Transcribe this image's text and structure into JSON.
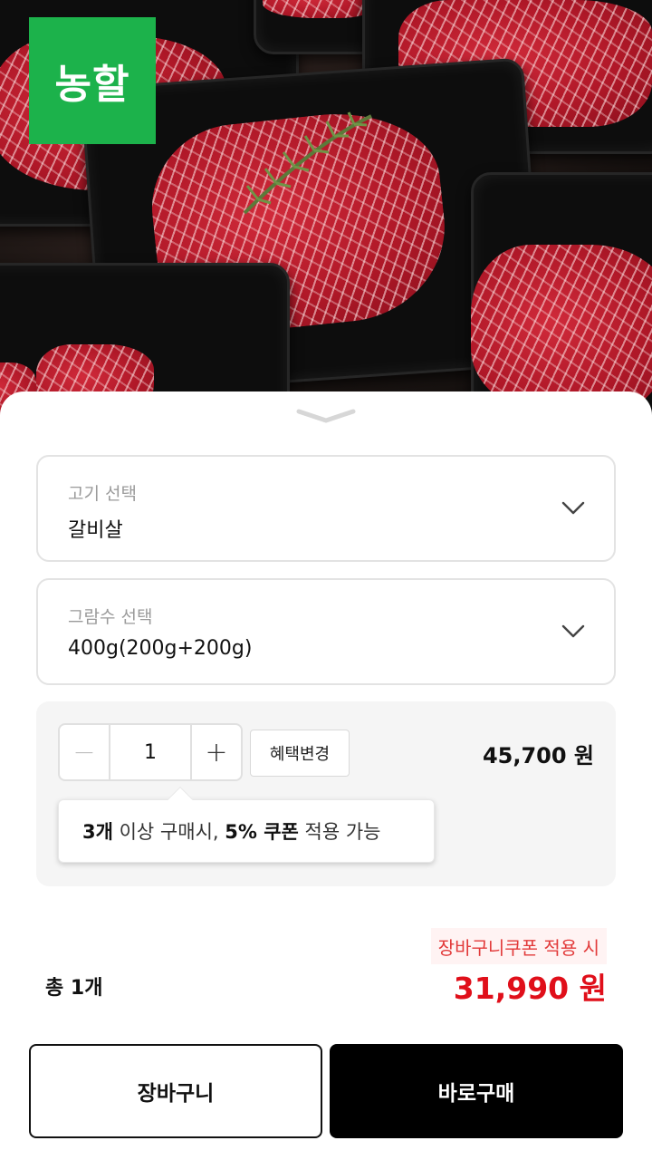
{
  "brand": {
    "logo_text": "농할"
  },
  "product_image": {
    "description_icon": "beef-photo"
  },
  "meat_select": {
    "label": "고기 선택",
    "value": "갈비살"
  },
  "weight_select": {
    "label": "그람수 선택",
    "value": "400g(200g+200g)"
  },
  "quantity": {
    "minus": "−",
    "value": "1",
    "plus": "+",
    "benefit_button": "혜택변경",
    "unit_price": "45,700 원",
    "tooltip": {
      "part1": "3개",
      "part2": " 이상 구매시, ",
      "part3": "5% 쿠폰",
      "part4": " 적용 가능"
    }
  },
  "summary": {
    "coupon_note": "장바구니쿠폰 적용 시",
    "total_count": "총 1개",
    "total_price": "31,990 원"
  },
  "actions": {
    "cart": "장바구니",
    "buy": "바로구매"
  },
  "colors": {
    "brand_green": "#1cb24b",
    "price_red": "#e00f1a",
    "coupon_red": "#e23a3a"
  }
}
